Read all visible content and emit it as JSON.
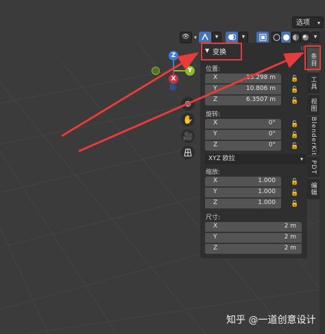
{
  "header": {
    "options_label": "选项",
    "viewport_buttons": [
      "eye-icon",
      "gizmo-icon",
      "overlay-icon",
      "xray-icon",
      "solid-icon",
      "material-icon",
      "rendered-icon"
    ]
  },
  "gizmo": {
    "axes": {
      "x": "X",
      "y": "Y",
      "z": "Z"
    }
  },
  "panel": {
    "title": "变换",
    "location": {
      "label": "位置:",
      "x": "13.298 m",
      "y": "10.806 m",
      "z": "6.3507 m"
    },
    "rotation": {
      "label": "旋转:",
      "x": "0°",
      "y": "0°",
      "z": "0°",
      "mode": "XYZ 欧拉"
    },
    "scale": {
      "label": "缩放:",
      "x": "1.000",
      "y": "1.000",
      "z": "1.000"
    },
    "dimensions": {
      "label": "尺寸:",
      "x": "2 m",
      "y": "2 m",
      "z": "2 m"
    },
    "axis_labels": {
      "x": "X",
      "y": "Y",
      "z": "Z"
    }
  },
  "tabs": [
    "条目",
    "工具",
    "视图",
    "BlenderKit",
    "PDT",
    "编辑"
  ],
  "watermark": "知乎 @一道创意设计"
}
